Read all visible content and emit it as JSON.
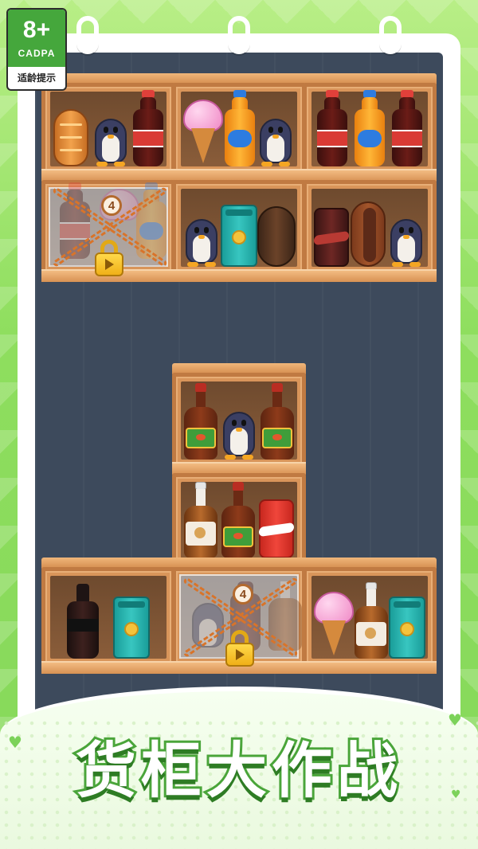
{
  "age_rating": {
    "number": "8+",
    "org": "CADPA",
    "tip": "适龄提示"
  },
  "title": "货柜大作战",
  "locks": [
    {
      "count": "4"
    },
    {
      "count": "4"
    }
  ],
  "shelves": {
    "top_left_upper": [
      "bread",
      "penguin",
      "cola-bottle"
    ],
    "top_mid_upper": [
      "ice-cream",
      "orange-soda-bottle",
      "penguin"
    ],
    "top_right_upper": [
      "cola-bottle",
      "orange-soda-bottle",
      "cola-bottle"
    ],
    "top_left_lower": [
      "locked"
    ],
    "top_mid_lower": [
      "penguin",
      "teal-box",
      "dark-bread"
    ],
    "top_right_lower": [
      "dark-can",
      "hotdog",
      "penguin"
    ],
    "center_upper": [
      "sauce-bottle",
      "penguin",
      "sauce-bottle"
    ],
    "center_lower": [
      "beer-bottle",
      "sauce-bottle",
      "red-can"
    ],
    "bottom_left": [
      "dark-bottle",
      "teal-box"
    ],
    "bottom_mid": [
      "locked"
    ],
    "bottom_right": [
      "ice-cream",
      "beer-bottle",
      "teal-box"
    ]
  },
  "colors": {
    "background_green": "#8ede5e",
    "board": "#3d4a5c",
    "shelf_wood": "#d9955a",
    "title_stroke": "#4aa53a",
    "badge_green": "#45a73c",
    "lock_gold": "#f0b018"
  }
}
